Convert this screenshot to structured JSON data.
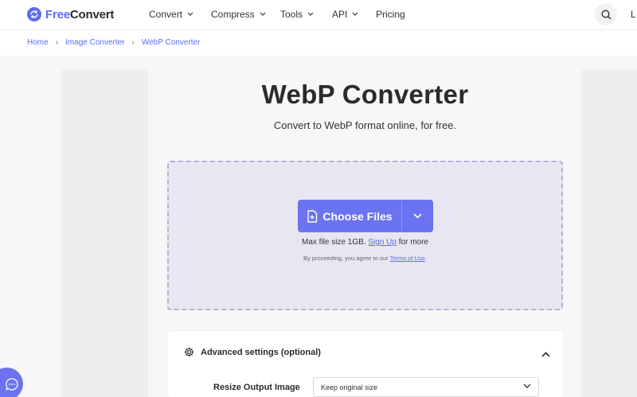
{
  "brand": {
    "name_part1": "Free",
    "name_part2": "Convert",
    "accent": "#5b6cf0"
  },
  "nav": {
    "items": [
      {
        "label": "Convert",
        "has_dropdown": true
      },
      {
        "label": "Compress",
        "has_dropdown": true
      },
      {
        "label": "Tools",
        "has_dropdown": true
      },
      {
        "label": "API",
        "has_dropdown": true
      },
      {
        "label": "Pricing",
        "has_dropdown": false
      }
    ],
    "search_icon": "search-icon",
    "login_partial": "L"
  },
  "breadcrumb": [
    "Home",
    "Image Converter",
    "WebP Converter"
  ],
  "hero": {
    "title": "WebP Converter",
    "subtitle": "Convert to WebP format online, for free."
  },
  "upload": {
    "choose_label": "Choose Files",
    "max_size_prefix": "Max file size 1GB.",
    "signup_link": "Sign Up",
    "max_size_suffix": "for more",
    "terms_prefix": "By proceeding, you agree to our",
    "terms_link": "Terms of Use",
    "terms_suffix": ".",
    "button_color": "#6b73f0"
  },
  "settings": {
    "title": "Advanced settings (optional)",
    "resize_label": "Resize Output Image",
    "resize_value": "Keep original size"
  }
}
